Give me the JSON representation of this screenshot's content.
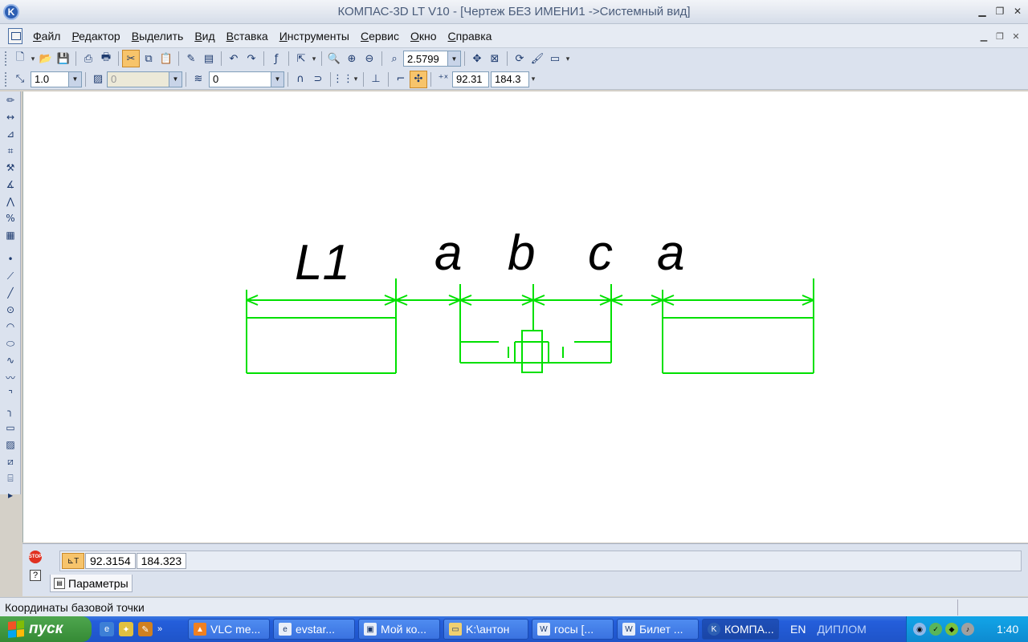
{
  "window": {
    "title": "КОМПАС-3D LT V10 - [Чертеж БЕЗ ИМЕНИ1 ->Системный вид]",
    "app_icon": "kompas-logo-icon"
  },
  "menu": {
    "items": [
      "Файл",
      "Редактор",
      "Выделить",
      "Вид",
      "Вставка",
      "Инструменты",
      "Сервис",
      "Окно",
      "Справка"
    ]
  },
  "toolbar1": {
    "zoom_value": "2.5799"
  },
  "toolbar2": {
    "scale_value": "1.0",
    "style_value": "0",
    "layer_value": "0",
    "coord_x": "92.31",
    "coord_y": "184.3"
  },
  "drawing": {
    "labels": [
      "L1",
      "a",
      "b",
      "c",
      "a"
    ],
    "line_color": "#00e000"
  },
  "properties": {
    "coord_x": "92.3154",
    "coord_y": "184.323",
    "tab_label": "Параметры"
  },
  "status": {
    "text": "Координаты базовой точки"
  },
  "taskbar": {
    "start_label": "пуск",
    "tasks": [
      {
        "label": "VLC me...",
        "icon": "vlc-icon"
      },
      {
        "label": "evstar...",
        "icon": "browser-icon"
      },
      {
        "label": "Мой ко...",
        "icon": "computer-icon"
      },
      {
        "label": "K:\\антон",
        "icon": "folder-icon"
      },
      {
        "label": "госы  [...",
        "icon": "word-icon"
      },
      {
        "label": "Билет ...",
        "icon": "word-icon"
      },
      {
        "label": "КОМПА...",
        "icon": "kompas-icon"
      }
    ],
    "language": "EN",
    "toolbar_label": "ДИПЛОМ",
    "clock": "1:40"
  }
}
